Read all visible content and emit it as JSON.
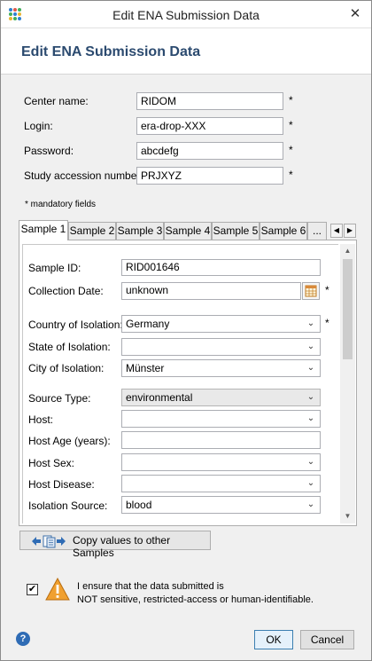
{
  "window": {
    "title": "Edit ENA Submission Data",
    "close_glyph": "✕"
  },
  "heading": "Edit ENA Submission Data",
  "form": {
    "center_name": {
      "label": "Center name:",
      "value": "RIDOM"
    },
    "login": {
      "label": "Login:",
      "value": "era-drop-XXX"
    },
    "password": {
      "label": "Password:",
      "value": "abcdefg"
    },
    "study_accession": {
      "label": "Study accession number:",
      "value": "PRJXYZ"
    },
    "required_marker": "*",
    "mandatory_note": "* mandatory fields"
  },
  "tabs": {
    "items": [
      "Sample 1",
      "Sample 2",
      "Sample 3",
      "Sample 4",
      "Sample 5",
      "Sample 6",
      "..."
    ],
    "active": "Sample 1",
    "scroll_left": "◀",
    "scroll_right": "▶"
  },
  "sample": {
    "sample_id": {
      "label": "Sample ID:",
      "value": "RID001646"
    },
    "collection_date": {
      "label": "Collection Date:",
      "value": "unknown",
      "icon": "calendar-icon"
    },
    "country": {
      "label": "Country of Isolation:",
      "value": "Germany"
    },
    "state": {
      "label": "State of Isolation:",
      "value": ""
    },
    "city": {
      "label": "City of Isolation:",
      "value": "Münster"
    },
    "source_type": {
      "label": "Source Type:",
      "value": "environmental"
    },
    "host": {
      "label": "Host:",
      "value": ""
    },
    "host_age": {
      "label": "Host Age (years):",
      "value": ""
    },
    "host_sex": {
      "label": "Host Sex:",
      "value": ""
    },
    "host_disease": {
      "label": "Host Disease:",
      "value": ""
    },
    "isolation_source": {
      "label": "Isolation Source:",
      "value": "blood"
    }
  },
  "copy_button": {
    "label": "Copy values to other Samples",
    "icon": "copy-samples-icon"
  },
  "consent": {
    "checked": true,
    "check_glyph": "✔",
    "line1": "I ensure that the data submitted is",
    "line2": "NOT sensitive, restricted-access or human-identifiable."
  },
  "footer": {
    "help_glyph": "?",
    "ok_label": "OK",
    "cancel_label": "Cancel"
  },
  "colors": {
    "heading": "#2b4a6f",
    "warning": "#f0a030",
    "help": "#2f6cb5",
    "ok_border": "#3c7fb1"
  }
}
